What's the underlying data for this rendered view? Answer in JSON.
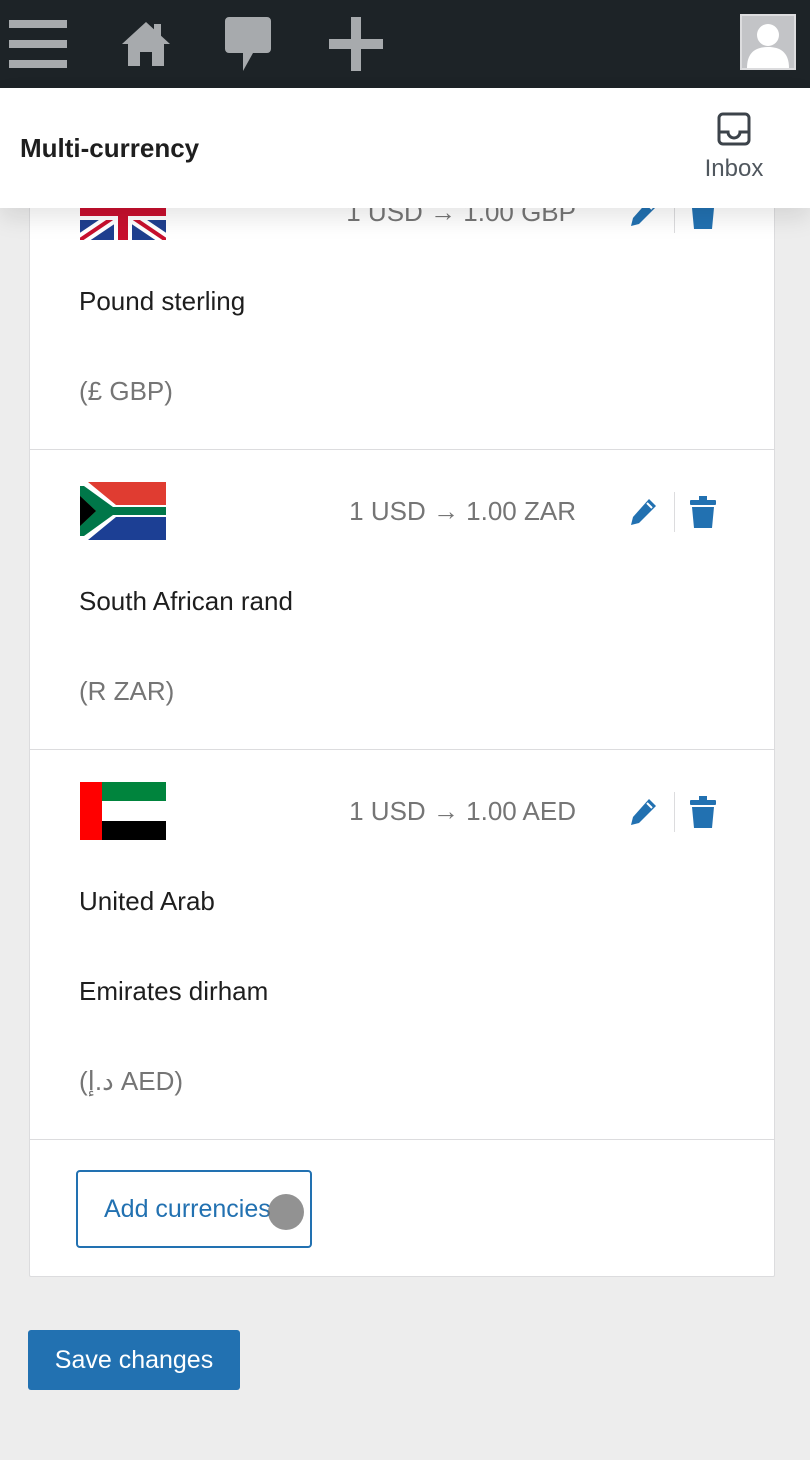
{
  "admin_bar": {
    "icons": [
      "menu-icon",
      "home-icon",
      "comment-icon",
      "plus-icon",
      "user-avatar-icon"
    ]
  },
  "header": {
    "title": "Multi-currency",
    "inbox_label": "Inbox"
  },
  "currencies": [
    {
      "name_lines": [
        "Pound sterling"
      ],
      "code": "(£ GBP)",
      "rate": "1 USD → 1.00 GBP",
      "flag": "uk-flag-icon"
    },
    {
      "name_lines": [
        "South African rand"
      ],
      "code": "(R ZAR)",
      "rate": "1 USD → 1.00 ZAR",
      "flag": "south-africa-flag-icon"
    },
    {
      "name_lines": [
        "United Arab",
        "Emirates dirham"
      ],
      "code": "(د.إ AED)",
      "rate": "1 USD → 1.00 AED",
      "flag": "uae-flag-icon"
    }
  ],
  "actions": {
    "add_currencies": "Add currencies",
    "save_changes": "Save changes"
  },
  "colors": {
    "admin_bar": "#1d2327",
    "accent": "#2271b1",
    "page_background": "#ededed"
  }
}
